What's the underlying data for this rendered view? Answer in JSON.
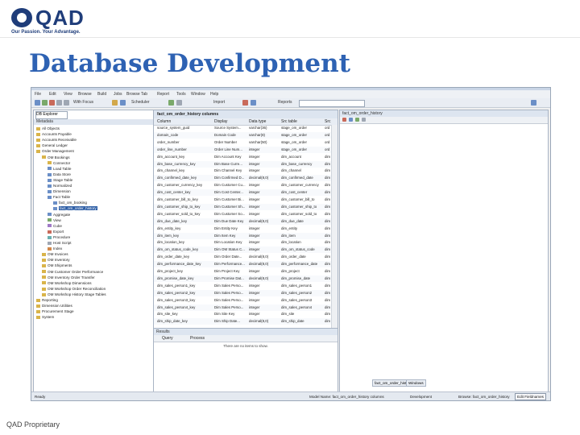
{
  "slide": {
    "logo_text": "QAD",
    "tagline": "Our Passion. Your Advantage.",
    "title": "Database Development",
    "footer": "QAD Proprietary"
  },
  "colors": {
    "brand": "#1f3d7a",
    "title": "#2e62b3",
    "selection": "#2f5fa6"
  },
  "app": {
    "menu": [
      "File",
      "Edit",
      "View",
      "Browse",
      "Build",
      "Jobs",
      "Browse",
      "Tab",
      "Report",
      "Tools",
      "Window",
      "Help"
    ],
    "toolbar": {
      "with_focus": "With Focus",
      "scheduler": "Scheduler",
      "import": "Import",
      "reports": "Reports"
    },
    "left_panel": {
      "tab": "DB Explorer",
      "header": "Metadata",
      "tree": [
        {
          "level": 0,
          "label": "All Objects",
          "icon": "folder-icon"
        },
        {
          "level": 0,
          "label": "Accounts Payable",
          "icon": "folder-icon"
        },
        {
          "level": 0,
          "label": "Accounts Receivable",
          "icon": "folder-icon"
        },
        {
          "level": 0,
          "label": "General Ledger",
          "icon": "folder-icon"
        },
        {
          "level": 0,
          "label": "Order Management",
          "icon": "folder-icon"
        },
        {
          "level": 1,
          "label": "OM Bookings",
          "icon": "folder-icon"
        },
        {
          "level": 2,
          "label": "Connector",
          "icon": "folder-icon"
        },
        {
          "level": 2,
          "label": "Load Table",
          "icon": "table-icon"
        },
        {
          "level": 2,
          "label": "Data Store",
          "icon": "table-icon"
        },
        {
          "level": 2,
          "label": "Stage Table",
          "icon": "table-icon"
        },
        {
          "level": 2,
          "label": "Normalized",
          "icon": "table-icon"
        },
        {
          "level": 2,
          "label": "Dimension",
          "icon": "table-icon"
        },
        {
          "level": 2,
          "label": "Fact Table",
          "icon": "table-icon"
        },
        {
          "level": 3,
          "label": "fact_om_booking",
          "icon": "table-icon"
        },
        {
          "level": 3,
          "label": "fact_om_order_history",
          "icon": "table-icon",
          "selected": true
        },
        {
          "level": 2,
          "label": "Aggregate",
          "icon": "table-icon"
        },
        {
          "level": 2,
          "label": "View",
          "icon": "view-icon"
        },
        {
          "level": 2,
          "label": "Cube",
          "icon": "cube-icon"
        },
        {
          "level": 2,
          "label": "Export",
          "icon": "export-icon"
        },
        {
          "level": 2,
          "label": "Procedure",
          "icon": "procedure-icon"
        },
        {
          "level": 2,
          "label": "Host Script",
          "icon": "script-icon"
        },
        {
          "level": 2,
          "label": "Index",
          "icon": "index-icon"
        },
        {
          "level": 1,
          "label": "OM Invoices",
          "icon": "folder-icon"
        },
        {
          "level": 1,
          "label": "OM Inventory",
          "icon": "folder-icon"
        },
        {
          "level": 1,
          "label": "OM Shipments",
          "icon": "folder-icon"
        },
        {
          "level": 1,
          "label": "OM Customer Order Performance",
          "icon": "folder-icon"
        },
        {
          "level": 1,
          "label": "OM Inventory Order Transfer",
          "icon": "folder-icon"
        },
        {
          "level": 1,
          "label": "OM Workshop Dimensions",
          "icon": "folder-icon"
        },
        {
          "level": 1,
          "label": "OM Workshop Order Reconciliation",
          "icon": "folder-icon"
        },
        {
          "level": 1,
          "label": "OM Workshop History Stage Tables",
          "icon": "folder-icon"
        },
        {
          "level": 0,
          "label": "Reporting",
          "icon": "folder-icon"
        },
        {
          "level": 0,
          "label": "Dimension Utilities",
          "icon": "folder-icon"
        },
        {
          "level": 0,
          "label": "Procurement Stage",
          "icon": "folder-icon"
        },
        {
          "level": 0,
          "label": "System",
          "icon": "folder-icon"
        }
      ]
    },
    "center_panel": {
      "title": "fact_om_order_history columns",
      "columns": [
        "Column",
        "Display",
        "Data type",
        "Src table",
        "Src"
      ],
      "rows": [
        [
          "source_system_guid",
          "Source System...",
          "varchar(36)",
          "stage_om_order",
          "ord"
        ],
        [
          "domain_code",
          "Domain Code",
          "varchar(8)",
          "stage_om_order",
          "ord"
        ],
        [
          "order_number",
          "Order Number",
          "varchar(50)",
          "stage_om_order",
          "ord"
        ],
        [
          "order_line_number",
          "Order Line Num...",
          "integer",
          "stage_om_order",
          "ord"
        ],
        [
          "dim_account_key",
          "Dim Account Key",
          "integer",
          "dim_account",
          "dim"
        ],
        [
          "dim_base_currency_key",
          "Dim Base Curre...",
          "integer",
          "dim_base_currency",
          "dim"
        ],
        [
          "dim_channel_key",
          "Dim Channel Key",
          "integer",
          "dim_channel",
          "dim"
        ],
        [
          "dim_confirmed_date_key",
          "Dim Confirmed D...",
          "decimal(8,0)",
          "dim_confirmed_date",
          "dim"
        ],
        [
          "dim_customer_currency_key",
          "Dim Customer Cu...",
          "integer",
          "dim_customer_currency",
          "dim"
        ],
        [
          "dim_cost_center_key",
          "Dim Cost Center...",
          "integer",
          "dim_cost_center",
          "dim"
        ],
        [
          "dim_customer_bill_to_key",
          "Dim Customer Bi...",
          "integer",
          "dim_customer_bill_to",
          "dim"
        ],
        [
          "dim_customer_ship_to_key",
          "Dim Customer Sh...",
          "integer",
          "dim_customer_ship_to",
          "dim"
        ],
        [
          "dim_customer_sold_to_key",
          "Dim Customer So...",
          "integer",
          "dim_customer_sold_to",
          "dim"
        ],
        [
          "dim_due_date_key",
          "Dim Due Date Key",
          "decimal(8,0)",
          "dim_due_date",
          "dim"
        ],
        [
          "dim_entity_key",
          "Dim Entity Key",
          "integer",
          "dim_entity",
          "dim"
        ],
        [
          "dim_item_key",
          "Dim Item Key",
          "integer",
          "dim_item",
          "dim"
        ],
        [
          "dim_location_key",
          "Dim Location Key",
          "integer",
          "dim_location",
          "dim"
        ],
        [
          "dim_om_status_code_key",
          "Dim OM Status C...",
          "integer",
          "dim_om_status_code",
          "dim"
        ],
        [
          "dim_order_date_key",
          "Dim Order Date...",
          "decimal(8,0)",
          "dim_order_date",
          "dim"
        ],
        [
          "dim_performance_date_key",
          "Dim Performance...",
          "decimal(8,0)",
          "dim_performance_date",
          "dim"
        ],
        [
          "dim_project_key",
          "Dim Project Key",
          "integer",
          "dim_project",
          "dim"
        ],
        [
          "dim_promise_date_key",
          "Dim Promise Dat...",
          "decimal(8,0)",
          "dim_promise_date",
          "dim"
        ],
        [
          "dim_sales_person1_key",
          "Dim Sales Perso...",
          "integer",
          "dim_sales_person1",
          "dim"
        ],
        [
          "dim_sales_person2_key",
          "Dim Sales Perso...",
          "integer",
          "dim_sales_person2",
          "dim"
        ],
        [
          "dim_sales_person3_key",
          "Dim Sales Perso...",
          "integer",
          "dim_sales_person3",
          "dim"
        ],
        [
          "dim_sales_person4_key",
          "Dim Sales Perso...",
          "integer",
          "dim_sales_person4",
          "dim"
        ],
        [
          "dim_site_key",
          "Dim Site Key",
          "integer",
          "dim_site",
          "dim"
        ],
        [
          "dim_ship_date_key",
          "Dim Ship Date...",
          "decimal(8,0)",
          "dim_ship_date",
          "dim"
        ]
      ]
    },
    "results_panel": {
      "title": "Results",
      "columns": [
        "Query",
        "Process"
      ],
      "message": "There are no items to show."
    },
    "right_panel": {
      "title": "fact_om_order_history",
      "tabs": [
        "fact_om_order_history",
        "Windows"
      ]
    },
    "status": {
      "left": "Ready",
      "middle": "Model Name: fact_om_order_history columns",
      "right": "Development",
      "user": "Browse: fact_om_order_history",
      "button": "Edit Fieldnames"
    }
  }
}
